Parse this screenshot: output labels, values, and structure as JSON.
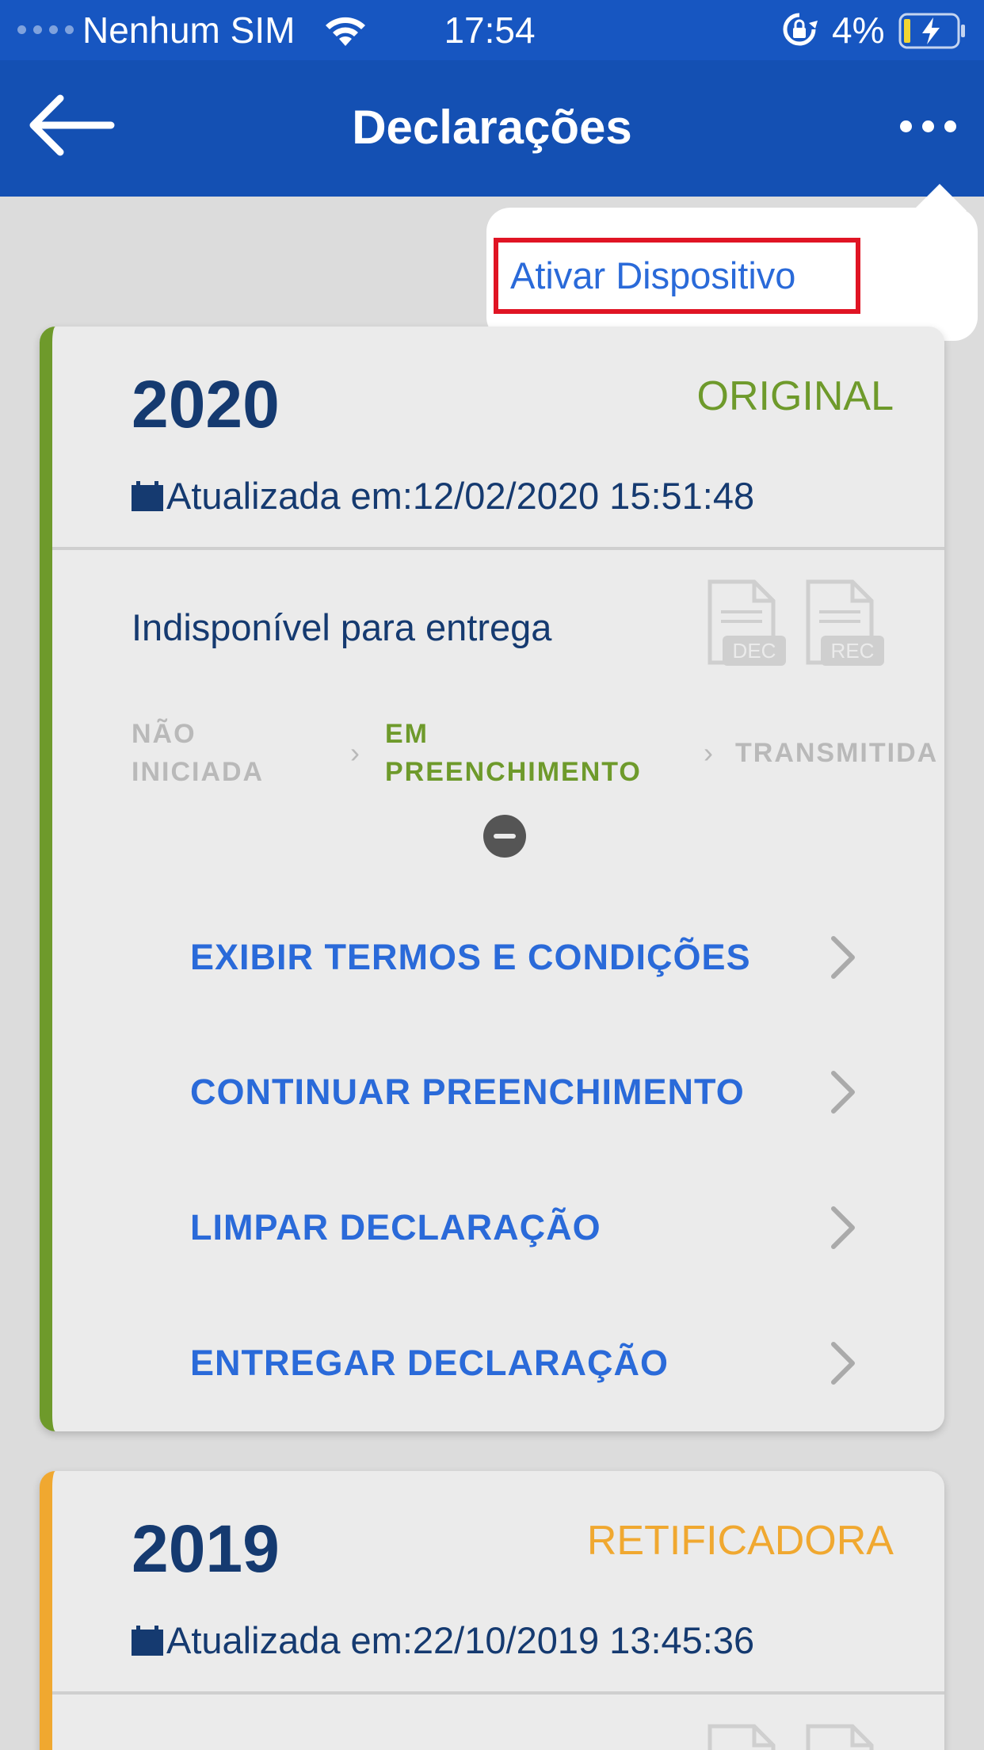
{
  "status_bar": {
    "carrier": "Nenhum SIM",
    "time": "17:54",
    "battery": "4%"
  },
  "nav": {
    "title": "Declarações"
  },
  "menu": {
    "items": [
      {
        "label": "Ativar Dispositivo"
      }
    ]
  },
  "cards": [
    {
      "year": "2020",
      "type": "ORIGINAL",
      "updated": "Atualizada em:12/02/2020 15:51:48",
      "availability": "Indisponível para entrega",
      "doc_icons": [
        "DEC",
        "REC"
      ],
      "steps": [
        {
          "line1": "NÃO",
          "line2": "INICIADA",
          "active": false
        },
        {
          "line1": "EM",
          "line2": "PREENCHIMENTO",
          "active": true
        },
        {
          "line1": "TRANSMITIDA",
          "line2": "",
          "active": false
        }
      ],
      "actions": [
        "EXIBIR TERMOS E CONDIÇÕES",
        "CONTINUAR PREENCHIMENTO",
        "LIMPAR DECLARAÇÃO",
        "ENTREGAR DECLARAÇÃO"
      ]
    },
    {
      "year": "2019",
      "type": "RETIFICADORA",
      "updated": "Atualizada em:22/10/2019 13:45:36"
    }
  ],
  "colors": {
    "header": "#1450b3",
    "status_bar": "#1756c1",
    "original": "#6e9a2b",
    "retificadora": "#f0a830",
    "action_link": "#2a6ad9",
    "menu_highlight": "#e01424"
  },
  "icons": [
    "back-arrow-icon",
    "more-icon",
    "wifi-icon",
    "orientation-lock-icon",
    "battery-charging-icon",
    "calendar-icon",
    "dec-document-icon",
    "rec-document-icon",
    "chevron-right-icon"
  ]
}
